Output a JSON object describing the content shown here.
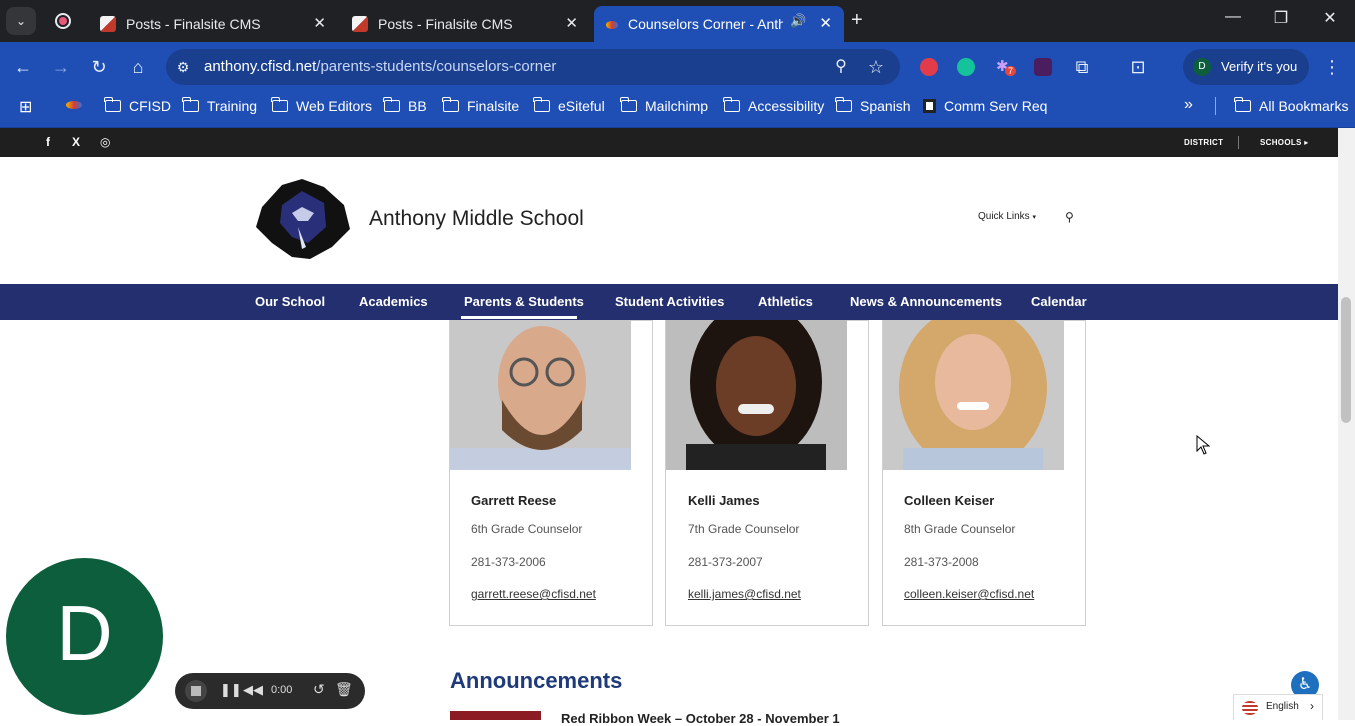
{
  "browser": {
    "tabs": [
      {
        "title": "Posts - Finalsite CMS"
      },
      {
        "title": "Posts - Finalsite CMS"
      },
      {
        "title": "Counselors Corner - Anthon"
      }
    ],
    "url_domain": "anthony.cfisd.net",
    "url_path": "/parents-students/counselors-corner",
    "profile_label": "Verify it's you",
    "profile_initial": "D",
    "extension_badge": "7",
    "bookmarks": [
      "CFISD",
      "Training",
      "Web Editors",
      "BB",
      "Finalsite",
      "eSiteful",
      "Mailchimp",
      "Accessibility",
      "Spanish",
      "Comm Serv Req"
    ],
    "all_bookmarks": "All Bookmarks"
  },
  "site": {
    "social": [
      "f",
      "X",
      "◎"
    ],
    "district_label": "DISTRICT",
    "schools_label": "SCHOOLS",
    "school_name": "Anthony Middle School",
    "quick_links": "Quick Links",
    "nav": [
      "Our School",
      "Academics",
      "Parents & Students",
      "Student Activities",
      "Athletics",
      "News & Announcements",
      "Calendar"
    ],
    "active_nav": "Parents & Students",
    "counselors": [
      {
        "name": "Garrett Reese",
        "role": "6th Grade Counselor",
        "phone": "281-373-2006",
        "email": "garrett.reese@cfisd.net"
      },
      {
        "name": "Kelli James",
        "role": "7th Grade Counselor",
        "phone": "281-373-2007",
        "email": "kelli.james@cfisd.net"
      },
      {
        "name": "Colleen Keiser",
        "role": "8th Grade Counselor",
        "phone": "281-373-2008",
        "email": "colleen.keiser@cfisd.net"
      }
    ],
    "announcements_heading": "Announcements",
    "announcement_title": "Red Ribbon Week – October 28 - November 1",
    "language": "English"
  },
  "recorder": {
    "avatar_letter": "D",
    "time": "0:00"
  },
  "colors": {
    "tabstrip": "#202124",
    "toolbar": "#1f4fb4",
    "nav": "#232f6e",
    "heading": "#1f3a7a",
    "recorder_avatar": "#0d5e3d"
  }
}
